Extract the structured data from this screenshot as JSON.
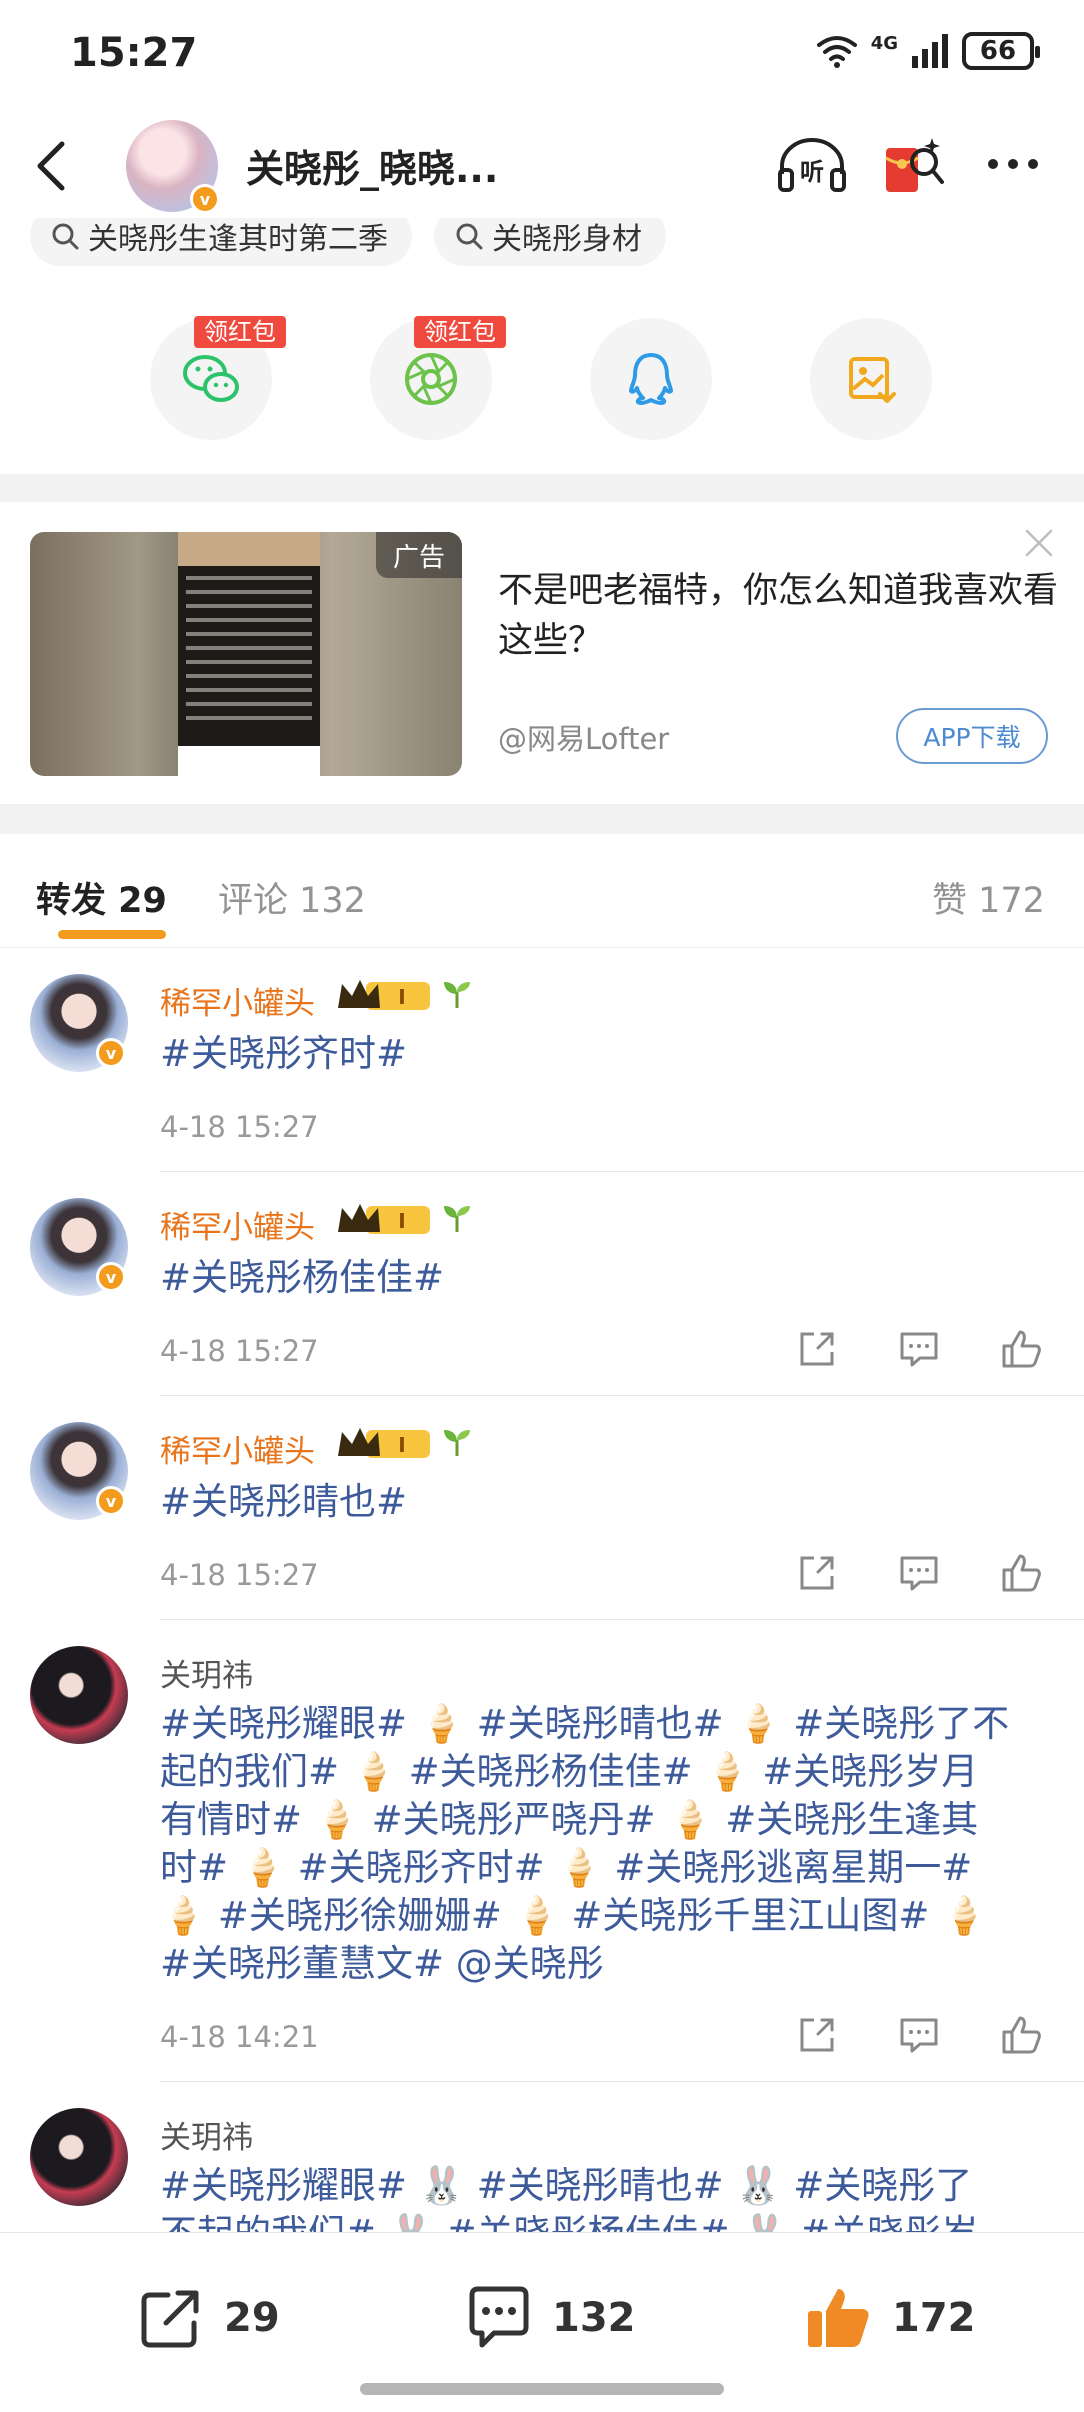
{
  "status_bar": {
    "time": "15:27",
    "network": "4G",
    "battery": "66"
  },
  "header": {
    "title": "关晓彤_晓晓...",
    "icons": [
      "back-icon",
      "listen-icon",
      "red-packet-icon",
      "more-icon"
    ]
  },
  "search_chips": [
    {
      "label": "关晓彤生逢其时第二季"
    },
    {
      "label": "关晓彤身材"
    }
  ],
  "share": {
    "badge": "领红包",
    "items": [
      "wechat",
      "moments",
      "qq",
      "save-image"
    ]
  },
  "ad": {
    "label": "广告",
    "title": "不是吧老福特，你怎么知道我喜欢看这些？",
    "source": "@网易Lofter",
    "button": "APP下载"
  },
  "tabs": {
    "repost": "转发 29",
    "comment": "评论 132",
    "like": "赞 172"
  },
  "list": [
    {
      "name": "稀罕小罐头",
      "text": "#关晓彤齐时#",
      "time": "4-18 15:27"
    },
    {
      "name": "稀罕小罐头",
      "text": "#关晓彤杨佳佳#",
      "time": "4-18 15:27"
    },
    {
      "name": "稀罕小罐头",
      "text": "#关晓彤晴也#",
      "time": "4-18 15:27"
    },
    {
      "name": "关玥祎",
      "lines": [
        "#关晓彤耀眼# 🍦 #关晓彤晴也# 🍦 #关晓彤了不",
        "起的我们# 🍦 #关晓彤杨佳佳# 🍦 #关晓彤岁月",
        "有情时# 🍦 #关晓彤严晓丹# 🍦 #关晓彤生逢其",
        "时# 🍦 #关晓彤齐时# 🍦 #关晓彤逃离星期一#",
        "🍦 #关晓彤徐姗姗# 🍦 #关晓彤千里江山图# 🍦",
        "#关晓彤董慧文# @关晓彤"
      ],
      "time": "4-18 14:21"
    },
    {
      "name": "关玥祎",
      "lines": [
        "#关晓彤耀眼# 🐰 #关晓彤晴也# 🐰 #关晓彤了",
        "不起的我们# 🐰 #关晓彤杨佳佳# 🐰 #关晓彤岁"
      ]
    }
  ],
  "bottom_bar": {
    "repost_count": "29",
    "comment_count": "132",
    "like_count": "172"
  },
  "colors": {
    "accent": "#f29b1d",
    "topic_link": "#3d5a9a",
    "vip_name": "#e8741c",
    "red_badge": "#f04a3f"
  }
}
